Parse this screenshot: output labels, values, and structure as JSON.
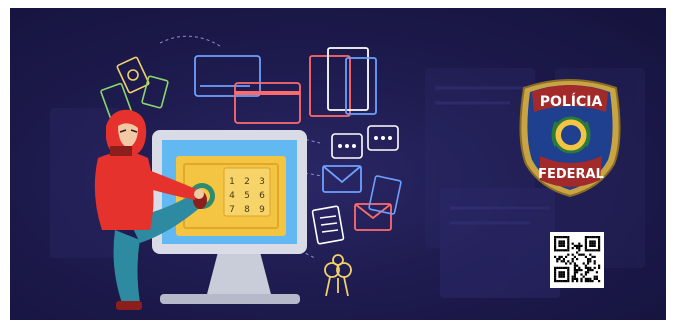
{
  "badge": {
    "top_text": "POLÍCIA",
    "bottom_text": "FEDERAL"
  },
  "keypad": {
    "keys": [
      "1",
      "2",
      "3",
      "4",
      "5",
      "6",
      "7",
      "8",
      "9"
    ]
  },
  "colors": {
    "background": "#1e1b4f",
    "monitor_frame": "#d9dbe6",
    "screen": "#62b8f0",
    "safe": "#f4c542",
    "hoodie": "#e5322d",
    "jeans": "#2e8aa0",
    "icon_line": "#f2d16b",
    "badge_gold": "#c8a445",
    "badge_blue": "#1f3f8f"
  },
  "icons": [
    "money-icon",
    "credit-card-icon",
    "folder-icon",
    "chat-icon",
    "envelope-icon",
    "document-icon",
    "keys-icon",
    "qr-code-icon"
  ]
}
